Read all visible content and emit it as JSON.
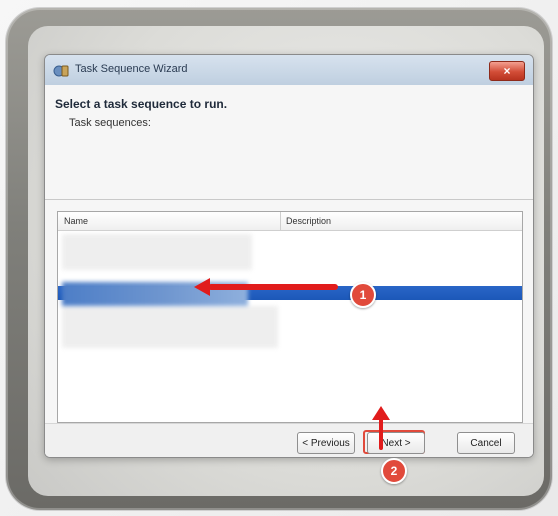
{
  "window": {
    "title": "Task Sequence Wizard",
    "close_glyph": "×",
    "app_icon": "task-sequence-icon"
  },
  "content": {
    "heading": "Select a task sequence to run.",
    "subheading": "Task sequences:"
  },
  "list": {
    "columns": [
      "Name",
      "Description"
    ]
  },
  "buttons": {
    "previous": "< Previous",
    "next": "Next >",
    "cancel": "Cancel"
  },
  "annotations": {
    "badge1": "1",
    "badge2": "2",
    "arrow_color": "#e11c1c",
    "badge_color": "#e14a3b"
  }
}
